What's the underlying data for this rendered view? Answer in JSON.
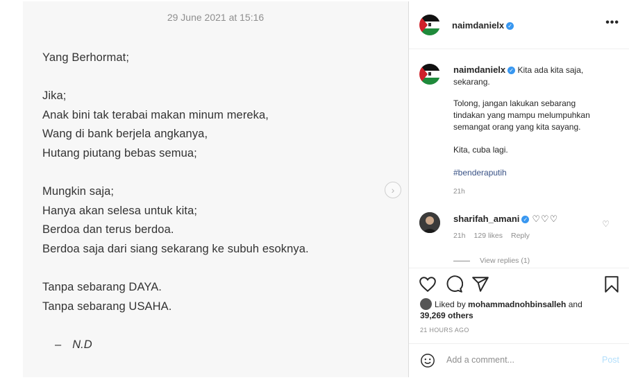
{
  "post": {
    "date": "29 June 2021 at 15:16",
    "lines": [
      "Yang Berhormat;",
      "",
      "Jika;",
      "Anak bini tak terabai makan minum mereka,",
      "Wang di bank berjela angkanya,",
      "Hutang piutang bebas semua;",
      "",
      "Mungkin saja;",
      "Hanya akan selesa untuk kita;",
      "Berdoa dan terus berdoa.",
      "Berdoa saja dari siang sekarang ke subuh esoknya.",
      "",
      "Tanpa sebarang DAYA.",
      "Tanpa sebarang USAHA."
    ],
    "signature_dash": "–",
    "signature": "N.D"
  },
  "header": {
    "username": "naimdanielx",
    "more": "•••"
  },
  "caption": {
    "username": "naimdanielx",
    "text1": "Kita ada kita saja, sekarang.",
    "text2": "Tolong, jangan lakukan sebarang tindakan yang mampu melumpuhkan semangat orang yang kita sayang.",
    "text3": "Kita, cuba lagi.",
    "hashtag": "#benderaputih",
    "time": "21h"
  },
  "comment": {
    "username": "sharifah_amani",
    "text": "♡♡♡",
    "time": "21h",
    "likes": "129 likes",
    "reply": "Reply",
    "view_replies": "View replies (1)"
  },
  "liked_by": {
    "prefix": "Liked by ",
    "user": "mohammadnohbinsalleh",
    "and": " and",
    "others": "39,269 others"
  },
  "time_ago": "21 HOURS AGO",
  "add_comment": {
    "placeholder": "Add a comment...",
    "post": "Post"
  },
  "icons": [
    "heart-icon",
    "comment-icon",
    "share-icon",
    "bookmark-icon",
    "emoji-icon",
    "verified-icon",
    "chevron-right-icon"
  ]
}
